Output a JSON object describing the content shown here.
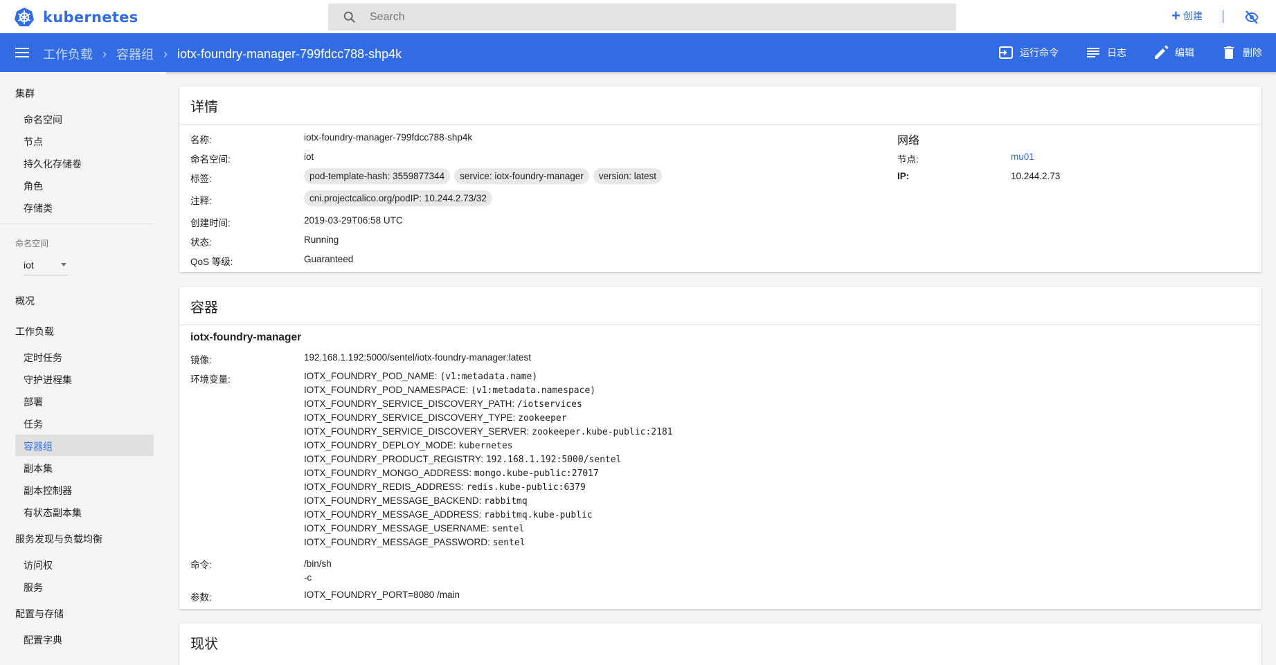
{
  "app": {
    "logo_text": "kubernetes"
  },
  "search": {
    "placeholder": "Search"
  },
  "topbar": {
    "create_label": "创建"
  },
  "breadcrumb": {
    "items": [
      "工作负载",
      "容器组"
    ],
    "current": "iotx-foundry-manager-799fdcc788-shp4k"
  },
  "actions": {
    "exec": "运行命令",
    "logs": "日志",
    "edit": "编辑",
    "delete": "删除"
  },
  "sidebar": {
    "cluster": "集群",
    "cluster_items": [
      "命名空间",
      "节点",
      "持久化存储卷",
      "角色",
      "存储类"
    ],
    "namespace_label": "命名空间",
    "namespace_value": "iot",
    "overview": "概况",
    "workloads": "工作负载",
    "workload_items": [
      "定时任务",
      "守护进程集",
      "部署",
      "任务",
      "容器组",
      "副本集",
      "副本控制器",
      "有状态副本集"
    ],
    "active_item": "容器组",
    "discovery": "服务发现与负载均衡",
    "discovery_items": [
      "访问权",
      "服务"
    ],
    "config": "配置与存储",
    "config_items": [
      "配置字典"
    ]
  },
  "details": {
    "title": "详情",
    "name_label": "名称:",
    "name": "iotx-foundry-manager-799fdcc788-shp4k",
    "namespace_label": "命名空间:",
    "namespace": "iot",
    "labels_label": "标签:",
    "labels": [
      "pod-template-hash: 3559877344",
      "service: iotx-foundry-manager",
      "version: latest"
    ],
    "annotations_label": "注释:",
    "annotations": [
      "cni.projectcalico.org/podIP:  10.244.2.73/32"
    ],
    "created_label": "创建时间:",
    "created": "2019-03-29T06:58 UTC",
    "status_label": "状态:",
    "status": "Running",
    "qos_label": "QoS 等级:",
    "qos": "Guaranteed",
    "network_title": "网络",
    "node_label": "节点:",
    "node": "mu01",
    "ip_label": "IP:",
    "ip": "10.244.2.73"
  },
  "containers": {
    "title": "容器",
    "name": "iotx-foundry-manager",
    "image_label": "镜像:",
    "image": "192.168.1.192:5000/sentel/iotx-foundry-manager:latest",
    "env_label": "环境变量:",
    "env": [
      {
        "key": "IOTX_FOUNDRY_POD_NAME:",
        "value": "(v1:metadata.name)"
      },
      {
        "key": "IOTX_FOUNDRY_POD_NAMESPACE:",
        "value": "(v1:metadata.namespace)"
      },
      {
        "key": "IOTX_FOUNDRY_SERVICE_DISCOVERY_PATH:",
        "value": "/iotservices"
      },
      {
        "key": "IOTX_FOUNDRY_SERVICE_DISCOVERY_TYPE:",
        "value": "zookeeper"
      },
      {
        "key": "IOTX_FOUNDRY_SERVICE_DISCOVERY_SERVER:",
        "value": "zookeeper.kube-public:2181"
      },
      {
        "key": "IOTX_FOUNDRY_DEPLOY_MODE:",
        "value": "kubernetes"
      },
      {
        "key": "IOTX_FOUNDRY_PRODUCT_REGISTRY:",
        "value": "192.168.1.192:5000/sentel"
      },
      {
        "key": "IOTX_FOUNDRY_MONGO_ADDRESS:",
        "value": "mongo.kube-public:27017"
      },
      {
        "key": "IOTX_FOUNDRY_REDIS_ADDRESS:",
        "value": "redis.kube-public:6379"
      },
      {
        "key": "IOTX_FOUNDRY_MESSAGE_BACKEND:",
        "value": "rabbitmq"
      },
      {
        "key": "IOTX_FOUNDRY_MESSAGE_ADDRESS:",
        "value": "rabbitmq.kube-public"
      },
      {
        "key": "IOTX_FOUNDRY_MESSAGE_USERNAME:",
        "value": "sentel"
      },
      {
        "key": "IOTX_FOUNDRY_MESSAGE_PASSWORD:",
        "value": "sentel"
      }
    ],
    "command_label": "命令:",
    "command": [
      "/bin/sh",
      "-c"
    ],
    "args_label": "参数:",
    "args": "IOTX_FOUNDRY_PORT=8080 /main"
  },
  "conditions": {
    "title": "现状"
  },
  "colors": {
    "brand": "#326ce5",
    "background": "#f5f5f5"
  }
}
